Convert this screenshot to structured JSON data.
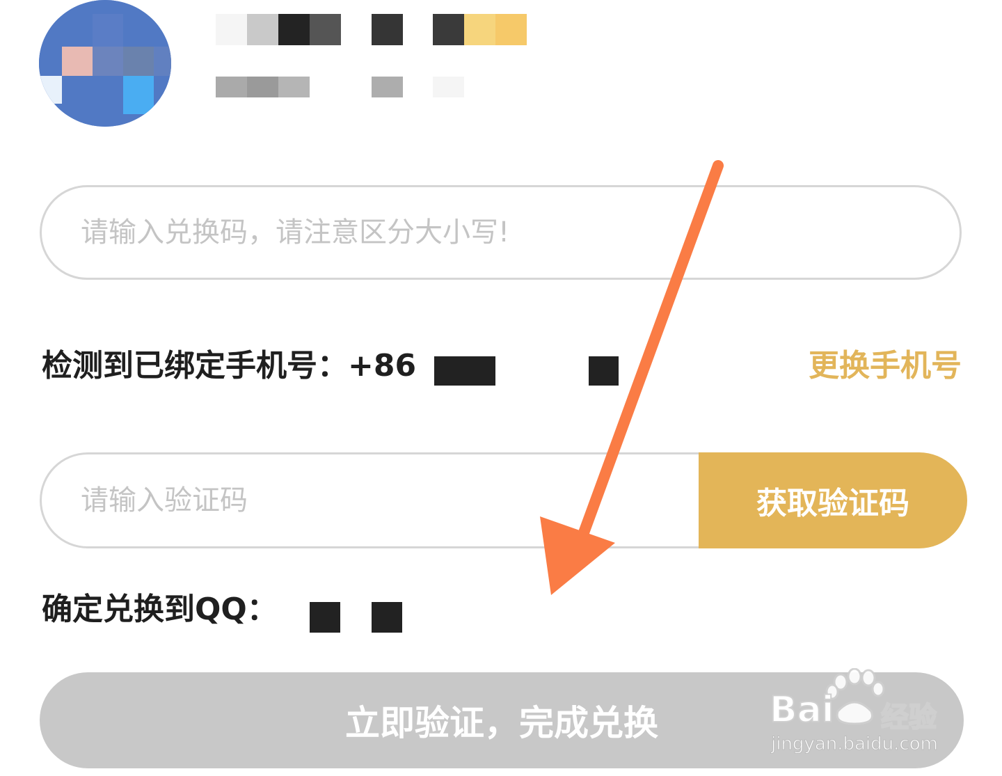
{
  "header": {
    "avatar_label": "avatar",
    "nickname_label": "nickname (pixelated)"
  },
  "redeem": {
    "code_placeholder": "请输入兑换码，请注意区分大小写!",
    "code_value": ""
  },
  "phone": {
    "label": "检测到已绑定手机号：+86",
    "change_label": "更换手机号"
  },
  "verify": {
    "placeholder": "请输入验证码",
    "value": "",
    "get_code_label": "获取验证码"
  },
  "qq": {
    "label": "确定兑换到QQ："
  },
  "submit": {
    "label": "立即验证，完成兑换"
  },
  "watermark": {
    "brand": "Bai",
    "brand_tail": "经验",
    "url": "jingyan.baidu.com"
  },
  "colors": {
    "accent": "#e3b558",
    "change_text": "#e2b55a",
    "disabled_button": "#c8c8c8",
    "arrow": "#fa7c45"
  },
  "icons": {
    "annotation": "arrow-down-left-icon"
  }
}
